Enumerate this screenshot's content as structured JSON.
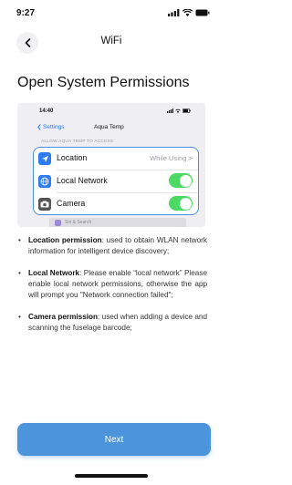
{
  "status_bar": {
    "time": "9:27"
  },
  "nav": {
    "title": "WiFi"
  },
  "page": {
    "heading": "Open System Permissions"
  },
  "screenshot": {
    "time": "14:40",
    "back_label": "Settings",
    "title": "Aqua Temp",
    "caption": "ALLOW AQUA TEMP TO ACCESS",
    "rows": [
      {
        "label": "Location",
        "value": "While Using >",
        "icon": "location-arrow-icon",
        "icon_color": "#2d7cf6"
      },
      {
        "label": "Local Network",
        "state": "on",
        "icon": "globe-icon",
        "icon_color": "#2d7cf6"
      },
      {
        "label": "Camera",
        "state": "on",
        "icon": "camera-icon",
        "icon_color": "#555555"
      }
    ],
    "peek_label": "Siri & Search"
  },
  "permissions": [
    {
      "title": "Location permission",
      "text": ": used to obtain WLAN network information for intelligent device discovery;"
    },
    {
      "title": "Local Network",
      "text": ": Please enable “local network” Please enable local network permissions, otherwise the app will prompt you \"Network connection failed\";"
    },
    {
      "title": "Camera permission",
      "text": ": used when adding a device and scanning the fuselage barcode;"
    }
  ],
  "footer": {
    "next_label": "Next"
  },
  "colors": {
    "accent": "#4c95dc",
    "toggle_on": "#4cd964",
    "ios_blue": "#2d7cf6"
  }
}
